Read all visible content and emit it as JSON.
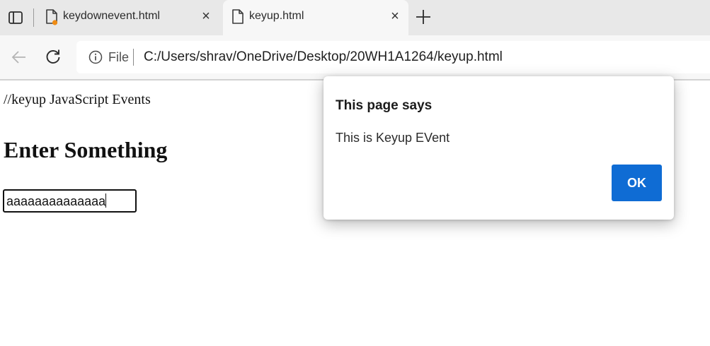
{
  "tabs": [
    {
      "title": "keydownevent.html",
      "close": "×"
    },
    {
      "title": "keyup.html",
      "close": "×"
    }
  ],
  "toolbar": {
    "scheme": "File",
    "url": "C:/Users/shrav/OneDrive/Desktop/20WH1A1264/keyup.html"
  },
  "page": {
    "comment": "//keyup JavaScript Events",
    "heading": "Enter Something",
    "input_value": "aaaaaaaaaaaaaa"
  },
  "dialog": {
    "title": "This page says",
    "message": "This is Keyup EVent",
    "ok_label": "OK"
  },
  "colors": {
    "accent": "#0f6cd4",
    "tab_strip": "#e8e8e8",
    "toolbar": "#f7f7f7",
    "notification_dot": "#f08c14"
  },
  "icons": [
    "tab-actions-icon",
    "file-icon",
    "new-tab-icon",
    "back-arrow-icon",
    "reload-icon",
    "info-icon"
  ]
}
